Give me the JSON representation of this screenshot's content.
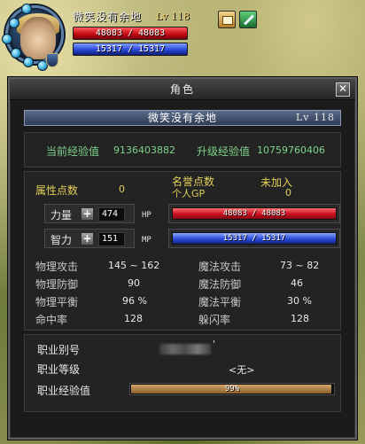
{
  "hud": {
    "name": "微笑没有余地",
    "level": "Lv 118",
    "hp": "48083 / 48083",
    "mp": "15317 / 15317"
  },
  "panel": {
    "title": "角色",
    "close_label": "✕",
    "char_name": "微笑没有余地",
    "char_level": "Lv 118",
    "exp": {
      "current_label": "当前经验值",
      "current_value": "9136403882",
      "next_label": "升级经验值",
      "next_value": "10759760406"
    },
    "points": {
      "attr_label": "属性点数",
      "attr_value": "0",
      "fame_label": "名誉点数",
      "fame_value": "未加入",
      "gp_label": "个人GP",
      "gp_value": "0"
    },
    "strength": {
      "label": "力量",
      "plus": "+",
      "value": "474",
      "bar_tag": "HP",
      "bar_text": "48083 / 48083",
      "fill": 1.0
    },
    "intellect": {
      "label": "智力",
      "plus": "+",
      "value": "151",
      "bar_tag": "MP",
      "bar_text": "15317 / 15317",
      "fill": 1.0
    },
    "stats": {
      "phys_atk_label": "物理攻击",
      "phys_atk_value": "145 ~ 162",
      "mag_atk_label": "魔法攻击",
      "mag_atk_value": "73 ~ 82",
      "phys_def_label": "物理防御",
      "phys_def_value": "90",
      "mag_def_label": "魔法防御",
      "mag_def_value": "46",
      "phys_bal_label": "物理平衡",
      "phys_bal_value": "96 %",
      "mag_bal_label": "魔法平衡",
      "mag_bal_value": "30 %",
      "hit_label": "命中率",
      "hit_value": "128",
      "dodge_label": "躲闪率",
      "dodge_value": "128"
    },
    "job": {
      "alias_label": "职业别号",
      "alias_suffix": "'",
      "level_label": "职业等级",
      "level_value": "<无>",
      "exp_label": "职业经验值",
      "exp_text": "99%",
      "exp_fill": 0.99
    }
  },
  "colors": {
    "label_green": "#7ed38a",
    "label_yellow": "#e2cf58",
    "hp_red": "#cc1020",
    "mp_blue": "#2c4cd8",
    "job_bar": "#b07a40"
  },
  "icons": [
    "scroll-icon",
    "sword-icon",
    "shield-emblem-icon",
    "close-icon",
    "plus-icon"
  ]
}
